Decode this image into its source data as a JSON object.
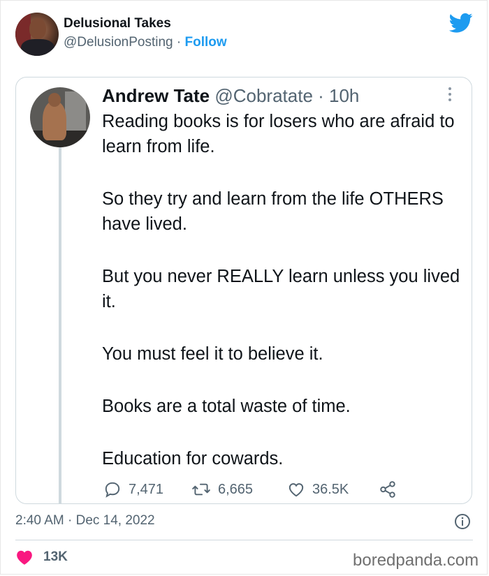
{
  "outer_tweet": {
    "author_name": "Delusional Takes",
    "handle": "@DelusionPosting",
    "separator": " · ",
    "follow_label": "Follow",
    "timestamp": "2:40 AM · Dec 14, 2022",
    "likes": "13K"
  },
  "quoted_tweet": {
    "author_name": "Andrew Tate",
    "handle_time": " @Cobratate · 10h",
    "paragraphs": [
      "Reading books is for losers who are afraid to learn from life.",
      "So they try and learn from the life OTHERS have lived.",
      "But you never REALLY learn unless you lived it.",
      "You must feel it to believe it.",
      "Books are a total waste of time.",
      "Education for cowards."
    ],
    "replies": "7,471",
    "retweets": "6,665",
    "likes": "36.5K"
  },
  "watermark": "boredpanda.com",
  "colors": {
    "accent": "#1d9bf0",
    "secondary_text": "#536471",
    "heart": "#f91880",
    "border": "#cfd9de"
  },
  "icons": {
    "brand": "twitter-bird-icon",
    "more": "more-vertical-icon",
    "reply": "reply-bubble-icon",
    "retweet": "retweet-icon",
    "like": "heart-outline-icon",
    "share": "share-icon",
    "info": "info-icon",
    "outer_like": "heart-filled-icon"
  }
}
